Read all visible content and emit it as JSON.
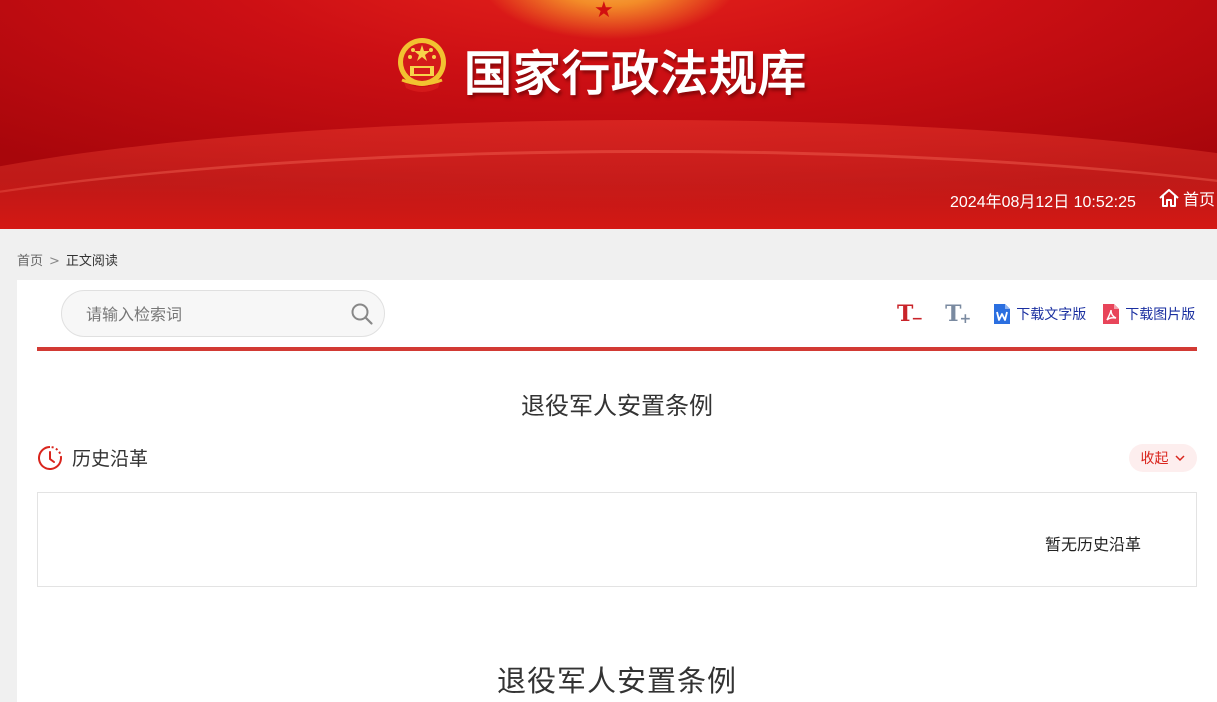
{
  "header": {
    "site_title": "国家行政法规库",
    "datetime": "2024年08月12日 10:52:25",
    "home_label": "首页"
  },
  "breadcrumb": {
    "home": "首页",
    "separator": ">",
    "current": "正文阅读"
  },
  "toolbar": {
    "search_placeholder": "请输入检索词",
    "font_decrease": "T",
    "font_decrease_sign": "−",
    "font_increase": "T",
    "font_increase_sign": "+",
    "download_word": "下载文字版",
    "download_image": "下载图片版"
  },
  "document": {
    "title": "退役军人安置条例",
    "history_label": "历史沿革",
    "collapse_label": "收起",
    "history_empty": "暂无历史沿革",
    "body_title": "退役军人安置条例"
  },
  "colors": {
    "brand_red": "#d23a34",
    "link_blue": "#1a2fa0",
    "collapse_bg": "#fdeeee"
  }
}
